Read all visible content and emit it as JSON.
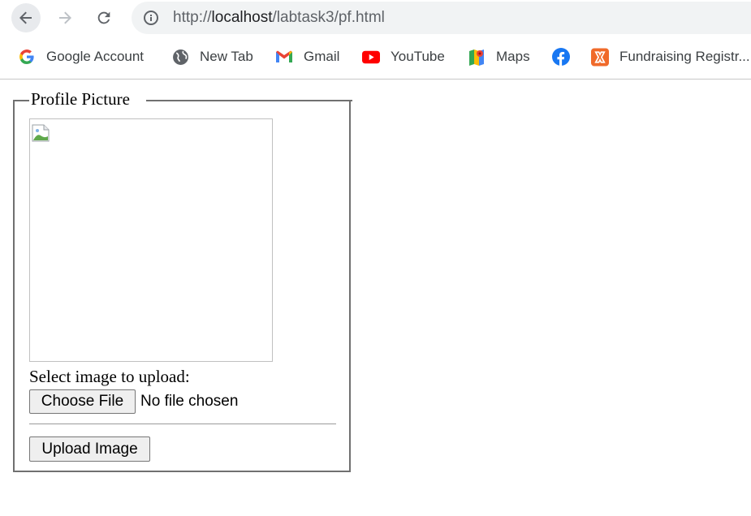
{
  "browser": {
    "url_prefix": "http://",
    "url_host": "localhost",
    "url_path": "/labtask3/pf.html",
    "nav": {
      "back_icon": "arrow-left-icon",
      "forward_icon": "arrow-right-icon",
      "reload_icon": "reload-icon",
      "info_icon": "info-icon"
    }
  },
  "bookmarks": [
    {
      "label": "Google Account",
      "icon": "google-icon"
    },
    {
      "label": "New Tab",
      "icon": "globe-icon"
    },
    {
      "label": "Gmail",
      "icon": "gmail-icon"
    },
    {
      "label": "YouTube",
      "icon": "youtube-icon"
    },
    {
      "label": "Maps",
      "icon": "maps-icon"
    },
    {
      "label": "",
      "icon": "facebook-icon"
    },
    {
      "label": "Fundraising Registr...",
      "icon": "xampp-icon"
    }
  ],
  "form": {
    "legend": "Profile Picture",
    "select_label": "Select image to upload:",
    "choose_button": "Choose File",
    "file_status": "No file chosen",
    "upload_button": "Upload Image"
  },
  "colors": {
    "toolbar_bg": "#ffffff",
    "omnibox_bg": "#f1f3f4",
    "youtube_red": "#ff0000",
    "facebook_blue": "#1877f2",
    "xampp_orange": "#f06a2a"
  }
}
